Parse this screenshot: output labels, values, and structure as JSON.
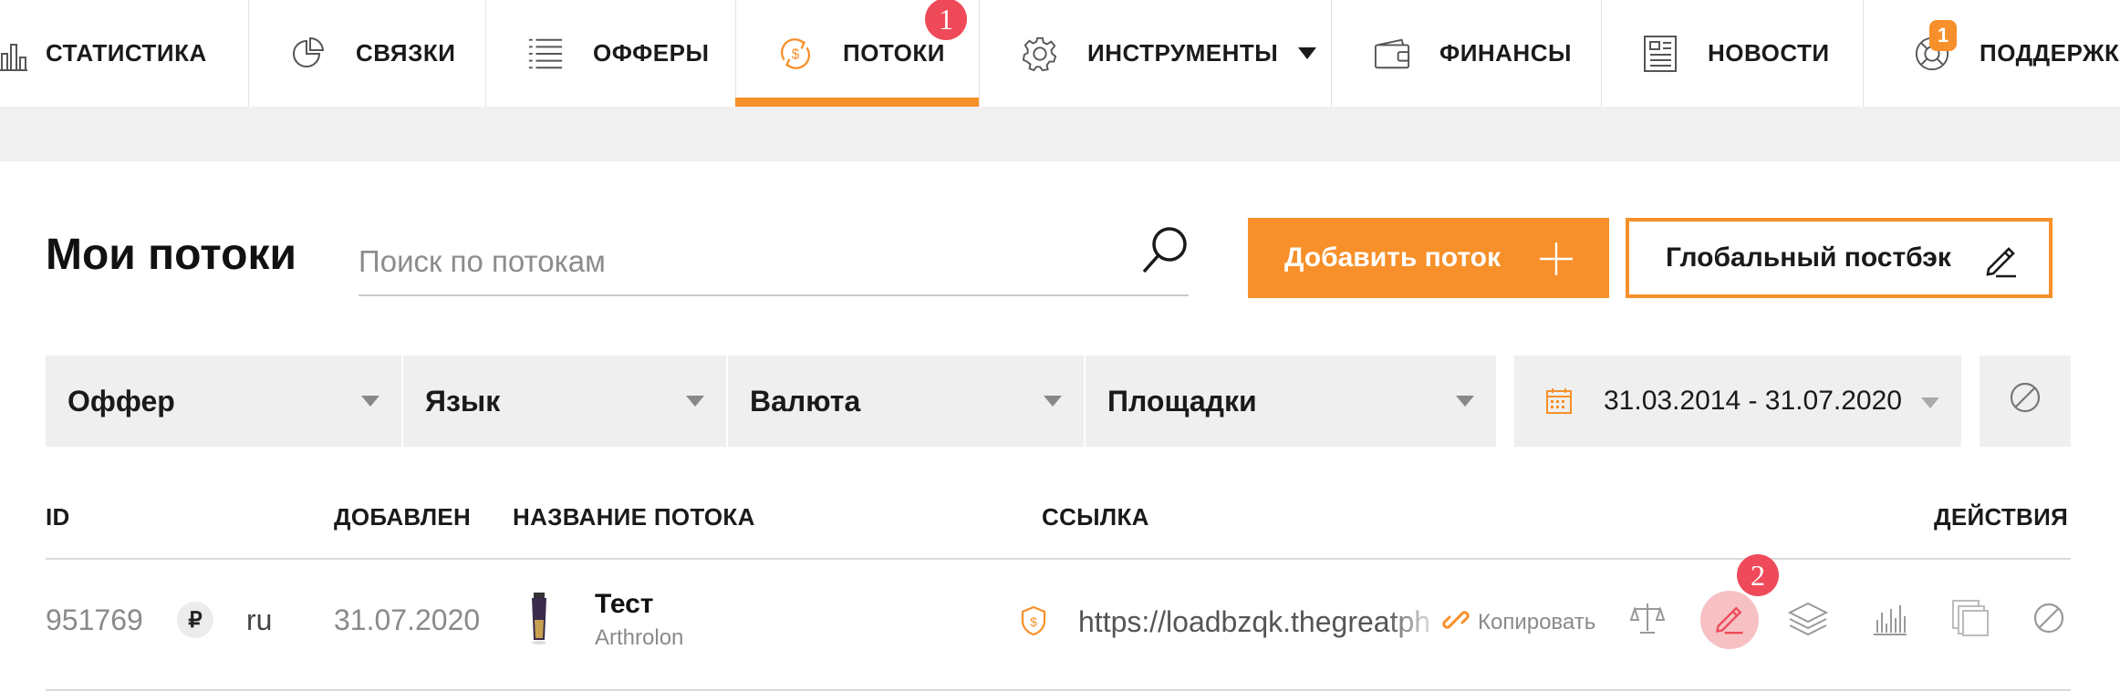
{
  "nav": {
    "items": [
      {
        "label": "СТАТИСТИКА",
        "icon": "bar-chart-icon"
      },
      {
        "label": "СВЯЗКИ",
        "icon": "pie-chart-icon"
      },
      {
        "label": "ОФФЕРЫ",
        "icon": "list-icon"
      },
      {
        "label": "ПОТОКИ",
        "icon": "dollar-cycle-icon",
        "active": true
      },
      {
        "label": "ИНСТРУМЕНТЫ",
        "icon": "gear-icon"
      },
      {
        "label": "ФИНАНСЫ",
        "icon": "wallet-icon"
      },
      {
        "label": "НОВОСТИ",
        "icon": "newspaper-icon"
      },
      {
        "label": "ПОДДЕРЖКА",
        "icon": "lifebuoy-icon",
        "badge": "1"
      }
    ],
    "annotation": "1",
    "accent_color": "#f7902a"
  },
  "header": {
    "title": "Мои потоки",
    "search_placeholder": "Поиск по потокам",
    "add_button": "Добавить поток",
    "postback_button": "Глобальный постбэк"
  },
  "filters": {
    "offer": "Оффер",
    "language": "Язык",
    "currency": "Валюта",
    "platforms": "Площадки",
    "date_range": "31.03.2014 - 31.07.2020"
  },
  "table": {
    "headers": {
      "id": "ID",
      "added": "ДОБАВЛЕН",
      "name": "НАЗВАНИЕ ПОТОКА",
      "link": "ССЫЛКА",
      "actions": "ДЕЙСТВИЯ"
    },
    "rows": [
      {
        "id": "951769",
        "currency_symbol": "₽",
        "lang": "ru",
        "added": "31.07.2020",
        "name": "Тест",
        "offer": "Arthrolon",
        "link": "https://loadbzqk.thegreatph",
        "copy_label": "Копировать"
      }
    ],
    "annotation": "2"
  }
}
